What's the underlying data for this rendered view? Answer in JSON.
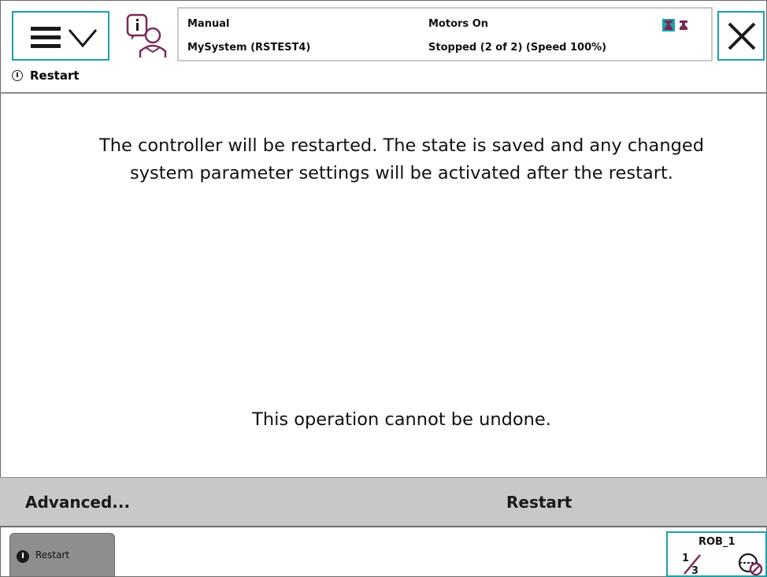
{
  "header": {
    "status": {
      "mode": "Manual",
      "system": "MySystem (RSTEST4)",
      "motors": "Motors On",
      "state": "Stopped (2 of 2) (Speed 100%)"
    },
    "breadcrumb": "Restart"
  },
  "main": {
    "message": "The controller will be restarted. The state is saved and any changed system parameter settings will be activated after the restart.",
    "warning": "This operation cannot be undone."
  },
  "command_bar": {
    "advanced_label": "Advanced...",
    "restart_label": "Restart"
  },
  "taskbar": {
    "task_label": "Restart",
    "mechanical_unit": "ROB_1"
  },
  "icons": {
    "menu": "hamburger-menu-icon",
    "menu_arrow": "chevron-down-icon",
    "event_log": "info-user-icon",
    "robot_status": "robot-icons",
    "close": "close-icon",
    "breadcrumb": "info-circle-icon",
    "increment": "increment-icon",
    "mechanical_unit": "mechanical-unit-icon"
  },
  "colors": {
    "accent": "#1aa3a8",
    "command_bar_bg": "#c8c8c8",
    "task_button_bg": "#8e8e8e",
    "icon_purple": "#7a2a5a"
  }
}
